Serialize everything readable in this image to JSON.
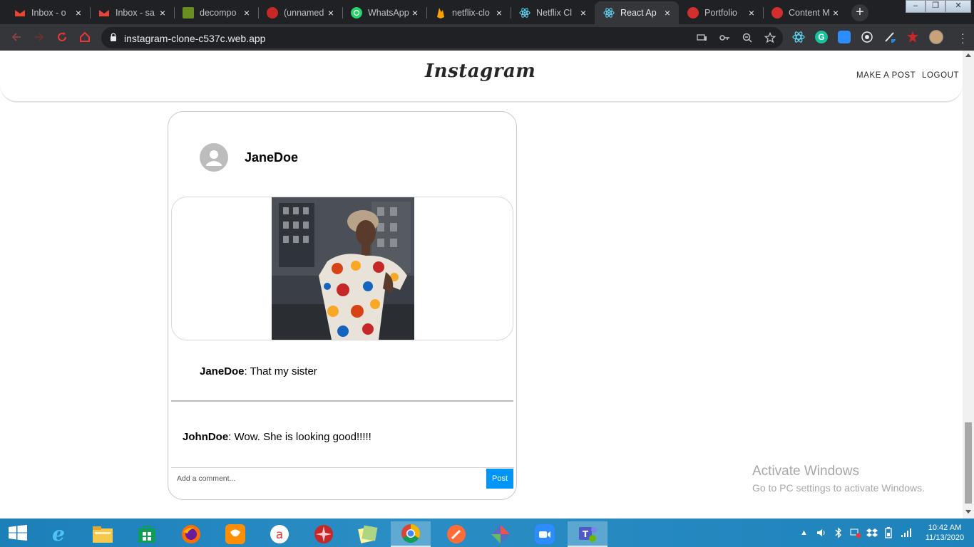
{
  "browser": {
    "tabs": [
      {
        "title": "Inbox - o",
        "favicon": "gmail-icon",
        "color": "#ea4335"
      },
      {
        "title": "Inbox - sa",
        "favicon": "gmail-icon",
        "color": "#ea4335"
      },
      {
        "title": "decompo",
        "favicon": "image-icon",
        "color": "#6b8e23"
      },
      {
        "title": "(unnamed",
        "favicon": "record-icon",
        "color": "#c62828"
      },
      {
        "title": "WhatsApp",
        "favicon": "whatsapp-icon",
        "color": "#25d366"
      },
      {
        "title": "netflix-clo",
        "favicon": "firebase-icon",
        "color": "#ffa000"
      },
      {
        "title": "Netflix Cl",
        "favicon": "react-icon",
        "color": "#61dafb"
      },
      {
        "title": "React Ap",
        "favicon": "react-icon",
        "color": "#61dafb"
      },
      {
        "title": "Portfolio",
        "favicon": "circle-icon",
        "color": "#d32f2f"
      },
      {
        "title": "Content M",
        "favicon": "circle-icon",
        "color": "#d32f2f"
      }
    ],
    "active_tab": 7,
    "new_tab_label": "+",
    "url": "instagram-clone-c537c.web.app"
  },
  "header": {
    "logo": "Instagram",
    "make_post": "MAKE A POST",
    "logout": "LOGOUT"
  },
  "post": {
    "username": "JaneDoe",
    "caption_user": "JaneDoe",
    "caption_text": ": That my sister",
    "comments": [
      {
        "user": "JohnDoe",
        "text": ": Wow. She is looking good!!!!!"
      }
    ],
    "comment_placeholder": "Add a comment...",
    "post_button": "Post"
  },
  "watermark": {
    "line1": "Activate Windows",
    "line2": "Go to PC settings to activate Windows."
  },
  "taskbar": {
    "time": "10:42 AM",
    "date": "11/13/2020"
  },
  "colors": {
    "accent": "#0095f6",
    "browser_bg": "#202124",
    "toolbar_bg": "#35363a",
    "taskbar": "#2a8dc4"
  }
}
